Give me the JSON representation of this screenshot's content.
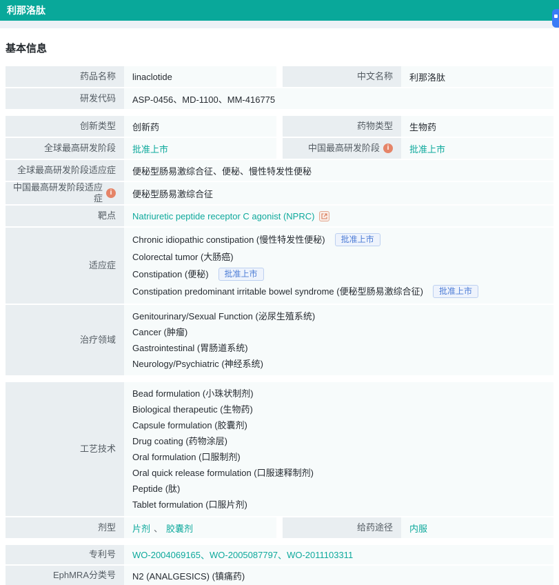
{
  "header": {
    "title": "利那洛肽"
  },
  "section": {
    "title": "基本信息"
  },
  "colors": {
    "accent_teal": "#09a89a",
    "link_teal": "#0ea99c",
    "badge_blue": "#4d7dd6",
    "info_orange": "#e58468",
    "float_button_blue": "#3a7bf6"
  },
  "icons": {
    "info": "info-icon",
    "target_external": "external-link-icon",
    "float_button": "feedback-button"
  },
  "fields": {
    "drug_name": {
      "label": "药品名称",
      "value": "linaclotide"
    },
    "cn_name": {
      "label": "中文名称",
      "value": "利那洛肽"
    },
    "rd_code": {
      "label": "研发代码",
      "value": "ASP-0456、MD-1100、MM-416775"
    },
    "innovation_type": {
      "label": "创新类型",
      "value": "创新药"
    },
    "drug_type": {
      "label": "药物类型",
      "value": "生物药"
    },
    "global_stage": {
      "label": "全球最高研发阶段",
      "value": "批准上市"
    },
    "cn_stage": {
      "label": "中国最高研发阶段",
      "value": "批准上市"
    },
    "global_stage_indication": {
      "label": "全球最高研发阶段适应症",
      "value": "便秘型肠易激综合征、便秘、慢性特发性便秘"
    },
    "cn_stage_indication": {
      "label": "中国最高研发阶段适应症",
      "value": "便秘型肠易激综合征"
    },
    "target": {
      "label": "靶点",
      "value": "Natriuretic peptide receptor C agonist (NPRC)"
    },
    "indications": {
      "label": "适应症",
      "items": [
        {
          "text": "Chronic idiopathic constipation (慢性特发性便秘)",
          "badge": "批准上市"
        },
        {
          "text": "Colorectal tumor (大肠癌)"
        },
        {
          "text": "Constipation (便秘)",
          "badge": "批准上市"
        },
        {
          "text": "Constipation predominant irritable bowel syndrome (便秘型肠易激综合征)",
          "badge": "批准上市"
        }
      ]
    },
    "therapy_areas": {
      "label": "治疗领域",
      "items": [
        "Genitourinary/Sexual Function (泌尿生殖系统)",
        "Cancer (肿瘤)",
        "Gastrointestinal (胃肠道系统)",
        "Neurology/Psychiatric (神经系统)"
      ]
    },
    "technologies": {
      "label": "工艺技术",
      "items": [
        "Bead formulation (小珠状制剂)",
        "Biological therapeutic (生物药)",
        "Capsule formulation (胶囊剂)",
        "Drug coating (药物涂层)",
        "Oral formulation (口服制剂)",
        "Oral quick release formulation (口服速释制剂)",
        "Peptide (肽)",
        "Tablet formulation (口服片剂)"
      ]
    },
    "dosage_form": {
      "label": "剂型",
      "link1": "片剂",
      "separator": "、",
      "link2": "胶囊剂"
    },
    "route": {
      "label": "给药途径",
      "value": "内服"
    },
    "patents": {
      "label": "专利号",
      "link1": "WO-2004069165",
      "link2": "WO-2005087797",
      "link3": "WO-2011103311",
      "separator": "、"
    },
    "ephmra": {
      "label": "EphMRA分类号",
      "value": "N2 (ANALGESICS) (镇痛药)"
    }
  }
}
